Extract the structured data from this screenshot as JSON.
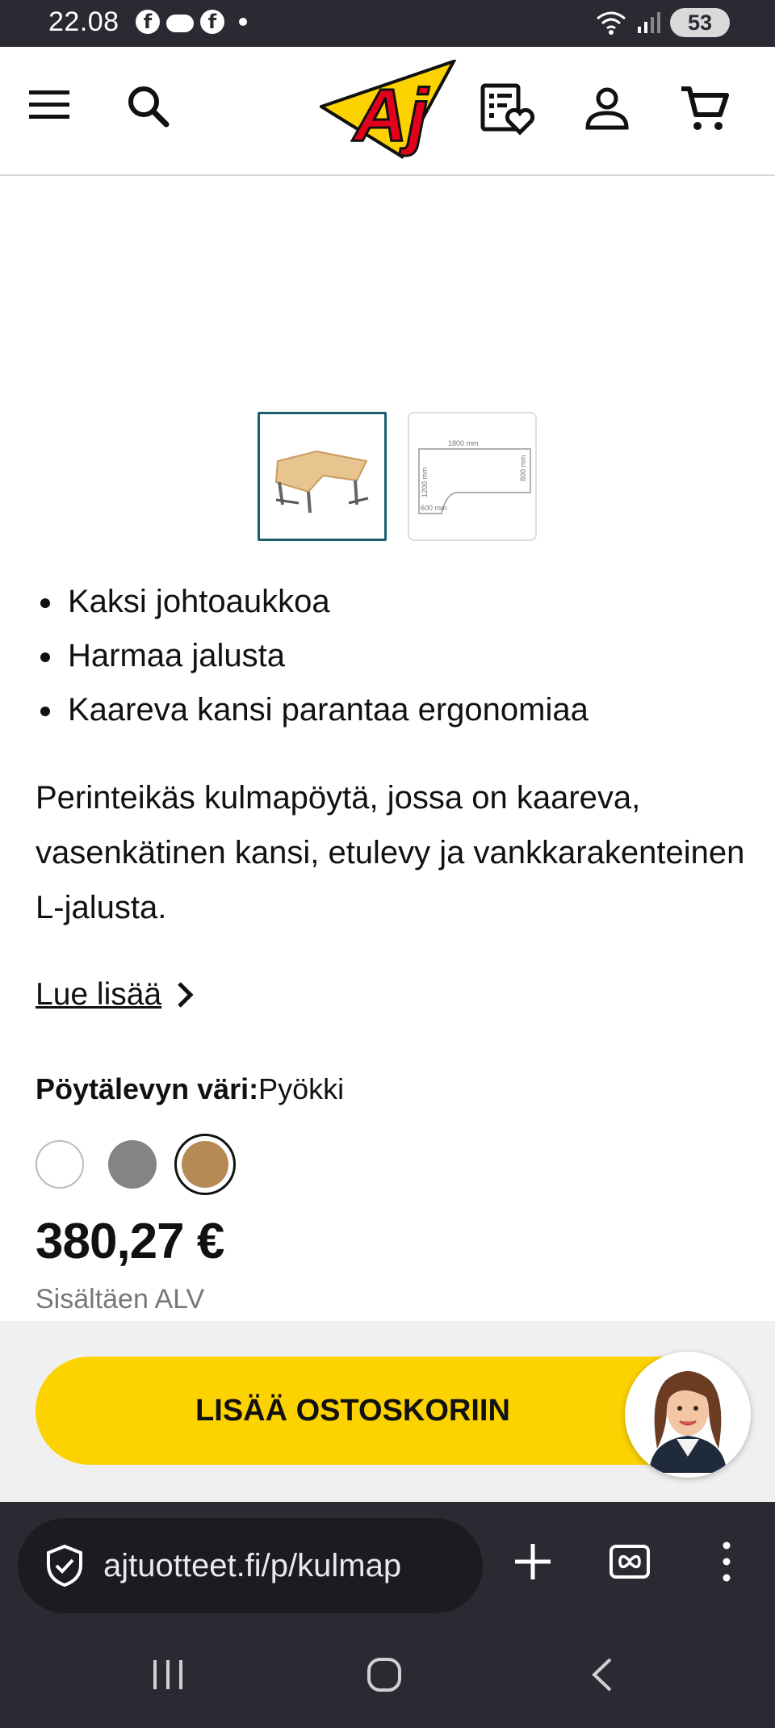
{
  "status_bar": {
    "time": "22.08",
    "battery": "53"
  },
  "header": {
    "logo_text": "Aj",
    "icons": [
      "menu-icon",
      "search-icon",
      "wishlist-icon",
      "account-icon",
      "cart-icon"
    ]
  },
  "gallery": {
    "thumbnails": [
      {
        "label": "desk-photo",
        "active": true
      },
      {
        "label": "dimensions-drawing",
        "dims": [
          "1800 mm",
          "800 mm",
          "1200 mm",
          "600 mm"
        ]
      }
    ]
  },
  "product": {
    "features": [
      "Kaksi johtoaukkoa",
      "Harmaa jalusta",
      "Kaareva kansi parantaa ergonomiaa"
    ],
    "description": "Perinteikäs kulmapöytä, jossa on kaareva, vasenkätinen kansi, etulevy ja vankkarakenteinen L-jalusta.",
    "read_more": "Lue lisää",
    "color_label": "Pöytälevyn väri:",
    "color_value": "Pyökki",
    "swatches": [
      {
        "name": "white",
        "color": "#ffffff"
      },
      {
        "name": "grey",
        "color": "#848484"
      },
      {
        "name": "beech",
        "color": "#b78a55",
        "selected": true
      }
    ],
    "price": "380,27 €",
    "vat_note": "Sisältäen ALV"
  },
  "cart": {
    "button_label": "LISÄÄ OSTOSKORIIN"
  },
  "browser": {
    "url": "ajtuotteet.fi/p/kulmap"
  },
  "colors": {
    "brand_yellow": "#fcd200",
    "dark_bar": "#2b2a33",
    "thumb_border": "#1b5f6f"
  }
}
